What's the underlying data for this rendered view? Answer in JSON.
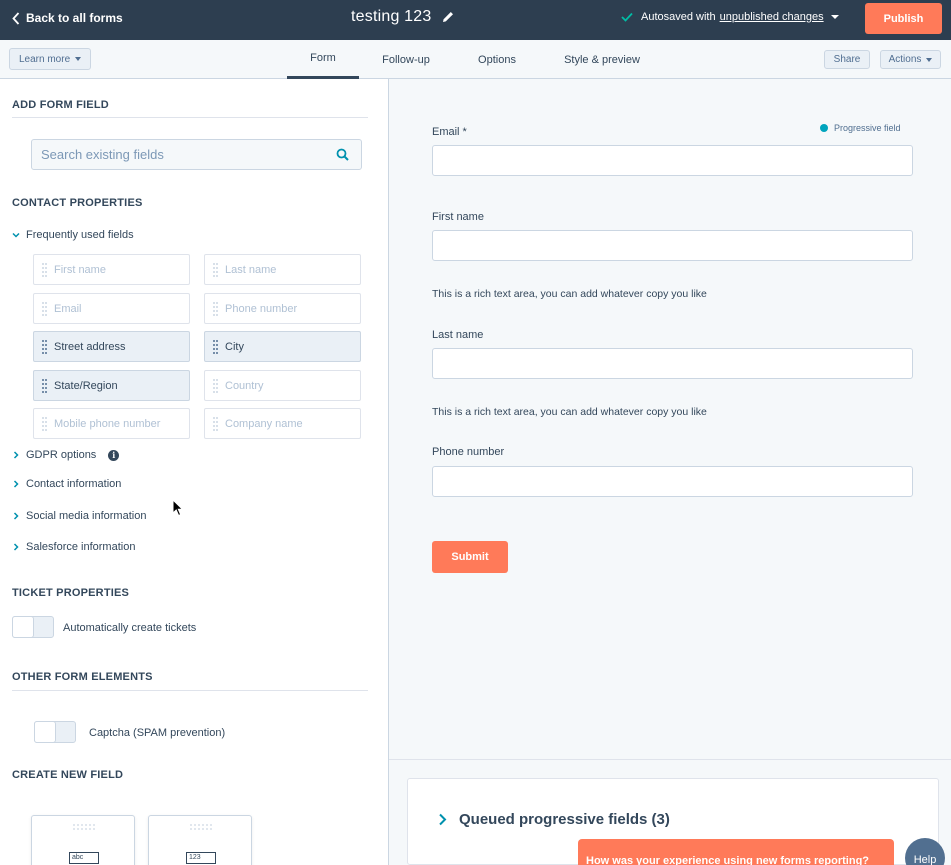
{
  "topbar": {
    "back_label": "Back to all forms",
    "title": "testing 123",
    "autosave_prefix": "Autosaved with",
    "autosave_link": "unpublished changes",
    "publish_label": "Publish"
  },
  "tabbar": {
    "learn_more": "Learn more",
    "tabs": [
      {
        "label": "Form",
        "active": true
      },
      {
        "label": "Follow-up",
        "active": false
      },
      {
        "label": "Options",
        "active": false
      },
      {
        "label": "Style & preview",
        "active": false
      }
    ],
    "share_label": "Share",
    "actions_label": "Actions"
  },
  "left": {
    "add_form_field": "ADD FORM FIELD",
    "search_placeholder": "Search existing fields",
    "contact_properties": "CONTACT PROPERTIES",
    "frequently_used": "Frequently used fields",
    "fields": [
      {
        "label": "First name",
        "added": false
      },
      {
        "label": "Last name",
        "added": false
      },
      {
        "label": "Email",
        "added": false
      },
      {
        "label": "Phone number",
        "added": false
      },
      {
        "label": "Street address",
        "added": true
      },
      {
        "label": "City",
        "added": true
      },
      {
        "label": "State/Region",
        "added": true
      },
      {
        "label": "Country",
        "added": false
      },
      {
        "label": "Mobile phone number",
        "added": false
      },
      {
        "label": "Company name",
        "added": false
      }
    ],
    "groups": [
      {
        "label": "GDPR options",
        "info": "i"
      },
      {
        "label": "Contact information"
      },
      {
        "label": "Social media information"
      },
      {
        "label": "Salesforce information"
      }
    ],
    "ticket_properties": "TICKET PROPERTIES",
    "auto_tickets": "Automatically create tickets",
    "other_elements": "OTHER FORM ELEMENTS",
    "captcha": "Captcha (SPAM prevention)",
    "create_new_field": "CREATE NEW FIELD",
    "new_cards": [
      {
        "glyph": "abc"
      },
      {
        "glyph": "123"
      }
    ]
  },
  "preview": {
    "progressive_legend": "Progressive field",
    "email_label": "Email *",
    "first_name_label": "First name",
    "rich_text_1": "This is a rich text area, you can add whatever copy you like",
    "last_name_label": "Last name",
    "rich_text_2": "This is a rich text area, you can add whatever copy you like",
    "phone_label": "Phone number",
    "submit_label": "Submit",
    "queued_label": "Queued progressive fields (3)"
  },
  "feedback": "How was your experience using new forms reporting?",
  "help_label": "Help",
  "colors": {
    "topbar": "#2d3e50",
    "accent": "#ff7a59",
    "progressive": "#00a4bd",
    "panel_bg": "#f5f8fa"
  }
}
